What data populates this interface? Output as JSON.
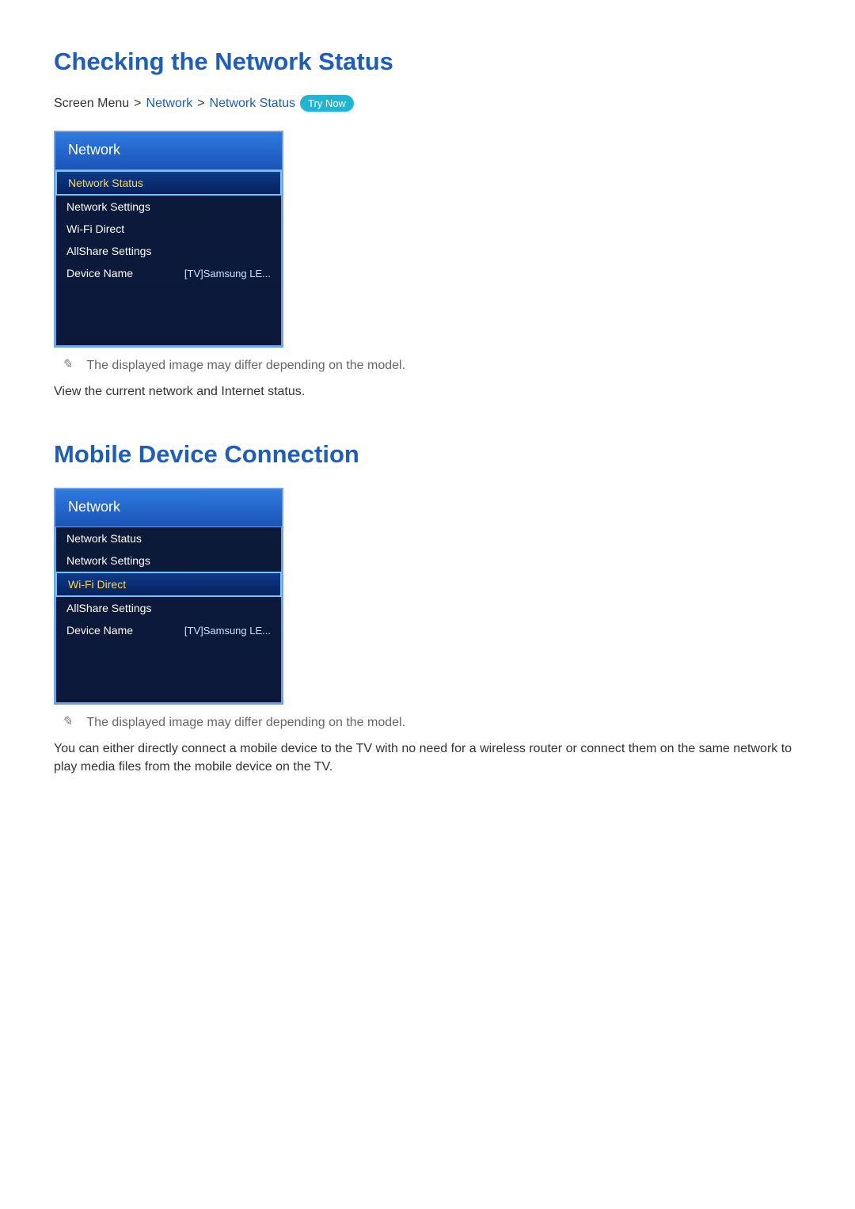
{
  "section1": {
    "heading": "Checking the Network Status",
    "breadcrumb": {
      "prefix": "Screen Menu",
      "part1": "Network",
      "part2": "Network Status",
      "try_now": "Try Now"
    },
    "menu": {
      "title": "Network",
      "selected_index": 0,
      "items": [
        {
          "label": "Network Status",
          "value": ""
        },
        {
          "label": "Network Settings",
          "value": ""
        },
        {
          "label": "Wi-Fi Direct",
          "value": ""
        },
        {
          "label": "AllShare Settings",
          "value": ""
        },
        {
          "label": "Device Name",
          "value": "[TV]Samsung LE..."
        }
      ]
    },
    "note": "The displayed image may differ depending on the model.",
    "description": "View the current network and Internet status."
  },
  "section2": {
    "heading": "Mobile Device Connection",
    "menu": {
      "title": "Network",
      "selected_index": 2,
      "items": [
        {
          "label": "Network Status",
          "value": ""
        },
        {
          "label": "Network Settings",
          "value": ""
        },
        {
          "label": "Wi-Fi Direct",
          "value": ""
        },
        {
          "label": "AllShare Settings",
          "value": ""
        },
        {
          "label": "Device Name",
          "value": "[TV]Samsung LE..."
        }
      ]
    },
    "note": "The displayed image may differ depending on the model.",
    "description": "You can either directly connect a mobile device to the TV with no need for a wireless router or connect them on the same network to play media files from the mobile device on the TV."
  }
}
